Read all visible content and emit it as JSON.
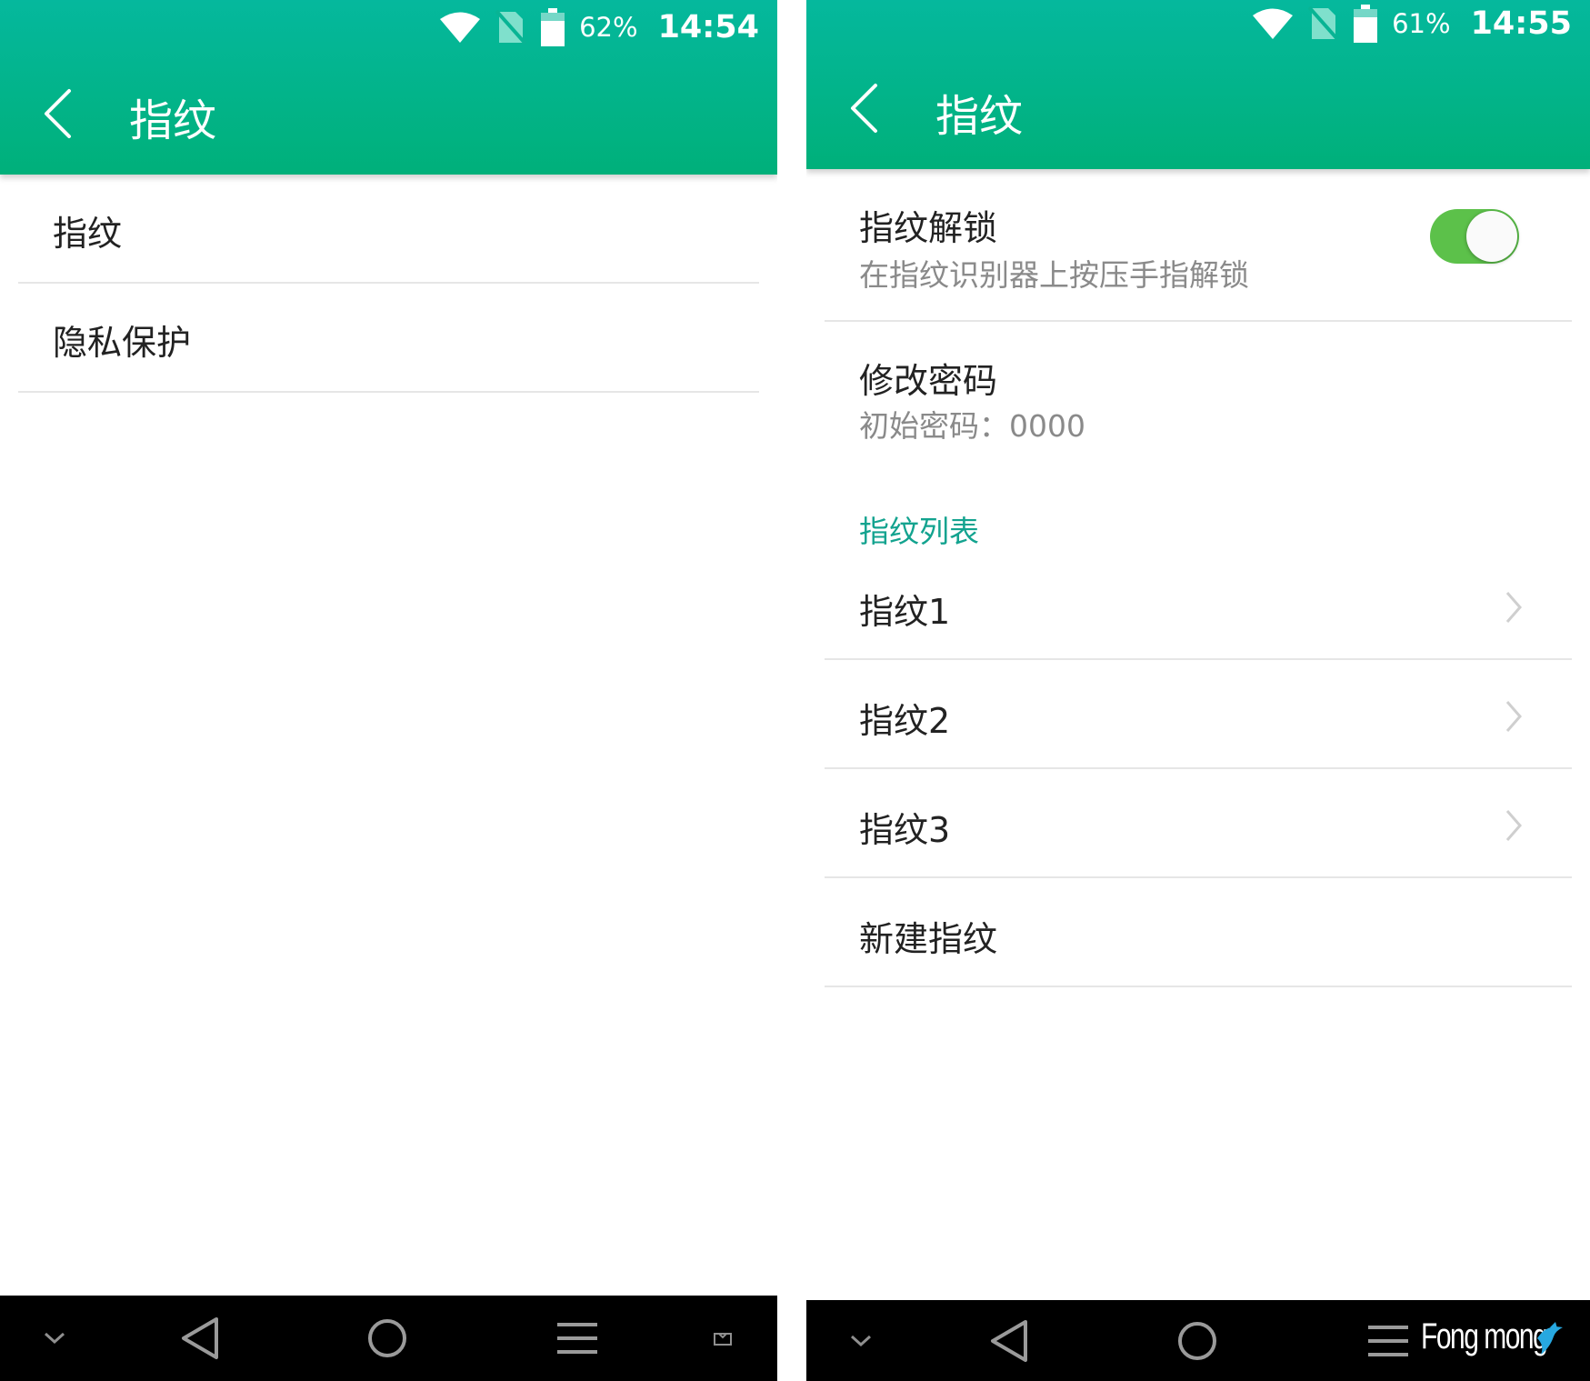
{
  "screens": [
    {
      "status": {
        "battery_pct": "62%",
        "time": "14:54"
      },
      "appbar": {
        "title": "指纹"
      },
      "items": [
        {
          "label": "指纹"
        },
        {
          "label": "隐私保护"
        }
      ]
    },
    {
      "status": {
        "battery_pct": "61%",
        "time": "14:55"
      },
      "appbar": {
        "title": "指纹"
      },
      "unlock": {
        "label": "指纹解锁",
        "subtitle": "在指纹识别器上按压手指解锁",
        "enabled": true
      },
      "password": {
        "label": "修改密码",
        "subtitle": "初始密码：0000"
      },
      "list_header": "指纹列表",
      "fingerprints": [
        {
          "label": "指纹1"
        },
        {
          "label": "指纹2"
        },
        {
          "label": "指纹3"
        }
      ],
      "add_label": "新建指纹"
    }
  ],
  "watermark": "Fong mong",
  "colors": {
    "accent": "#00b38a",
    "toggle_on": "#5cc14a",
    "section_header": "#13a38f",
    "navbar": "#000000"
  },
  "icons": [
    "wifi-icon",
    "no-sim-icon",
    "battery-icon",
    "back-arrow-icon",
    "chevron-right-icon",
    "nav-collapse-icon",
    "nav-back-icon",
    "nav-home-icon",
    "nav-menu-icon",
    "screenshot-icon",
    "dolphin-logo-icon"
  ]
}
